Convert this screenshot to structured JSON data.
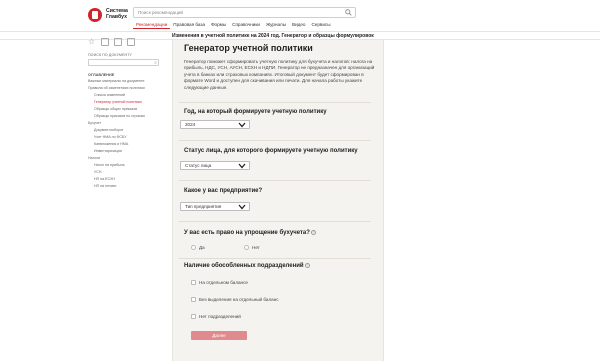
{
  "header": {
    "logo_line1": "Система",
    "logo_line2": "Главбух",
    "search_placeholder": "Поиск рекомендаций",
    "nav": [
      "Рекомендации",
      "Правовая база",
      "Формы",
      "Справочники",
      "Журналы",
      "Видео",
      "Сервисы"
    ]
  },
  "breadcrumb": "Изменения в учетной политике на 2024 год. Генератор и образцы формулировок",
  "sidebar": {
    "search_label": "ПОИСК ПО ДОКУМЕНТУ",
    "section_title": "ОГЛАВЛЕНИЕ",
    "items": [
      {
        "label": "Важные материалы на документе",
        "level": 1,
        "active": false
      },
      {
        "label": "Правила об изменениях политики",
        "level": 1,
        "active": false
      },
      {
        "label": "Список изменений",
        "level": 2,
        "active": false
      },
      {
        "label": "Генератор учетной политики",
        "level": 2,
        "active": true
      },
      {
        "label": "Образцы общих приказов",
        "level": 2,
        "active": false
      },
      {
        "label": "Образцы приказов по строкам",
        "level": 2,
        "active": false
      },
      {
        "label": "Бухучет",
        "level": 1,
        "active": false
      },
      {
        "label": "Документооборот",
        "level": 2,
        "active": false
      },
      {
        "label": "Учет НМА по ФСБУ",
        "level": 2,
        "active": false
      },
      {
        "label": "Капвложения и НМА",
        "level": 2,
        "active": false
      },
      {
        "label": "Инвентаризация",
        "level": 2,
        "active": false
      },
      {
        "label": "Налоги",
        "level": 1,
        "active": false
      },
      {
        "label": "Налог на прибыль",
        "level": 2,
        "active": false
      },
      {
        "label": "УСН",
        "level": 2,
        "active": false
      },
      {
        "label": "НП на ЕСХН",
        "level": 2,
        "active": false
      },
      {
        "label": "НП на печати",
        "level": 2,
        "active": false
      }
    ]
  },
  "main": {
    "title": "Генератор учетной политики",
    "description": "Генератор поможет сформировать учетную политику для бухучета и налогов: налога на прибыль, НДС, УСН, АУСН, ЕСХН и НДПИ. Генератор не предназначен для организаций учета в банках или страховых компаниях. Итоговый документ будет сформирован в формате Word и доступен для скачивания или печати. Для начала работы укажите следующие данные.",
    "q1": {
      "title": "Год, на который формируете учетную политику",
      "value": "2024"
    },
    "q2": {
      "title": "Статус лица, для которого формируете учетную политику",
      "value": "Статус лица"
    },
    "q3": {
      "title": "Какое у вас предприятие?",
      "value": "Тип предприятия"
    },
    "q4": {
      "title": "У вас есть право на упрощение бухучета?",
      "options": [
        "Да",
        "Нет"
      ]
    },
    "q5": {
      "title": "Наличие обособленных подразделений",
      "options": [
        "На отдельном балансе",
        "Без выделения на отдельный баланс",
        "Нет подразделений"
      ]
    },
    "submit_label": "Далее"
  },
  "colors": {
    "accent": "#d1252c",
    "panel": "#f4f3ef",
    "submit": "#e08a8d"
  }
}
